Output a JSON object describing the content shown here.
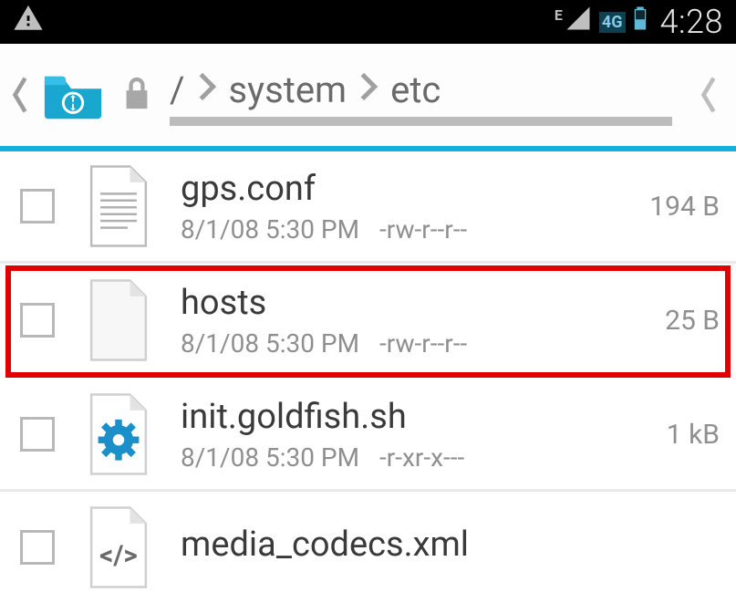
{
  "statusbar": {
    "network_type": "E",
    "data_label": "4G",
    "time": "4:28"
  },
  "breadcrumb": {
    "root": "/",
    "segments": [
      "system",
      "etc"
    ]
  },
  "files": [
    {
      "name": "gps.conf",
      "date": "8/1/08 5:30 PM",
      "perms": "-rw-r--r--",
      "size": "194 B",
      "icon": "text",
      "highlighted": false
    },
    {
      "name": "hosts",
      "date": "8/1/08 5:30 PM",
      "perms": "-rw-r--r--",
      "size": "25 B",
      "icon": "blank",
      "highlighted": true
    },
    {
      "name": "init.goldfish.sh",
      "date": "8/1/08 5:30 PM",
      "perms": "-r-xr-x---",
      "size": "1 kB",
      "icon": "gear",
      "highlighted": false
    },
    {
      "name": "media_codecs.xml",
      "date": "",
      "perms": "",
      "size": "",
      "icon": "code",
      "highlighted": false
    }
  ]
}
